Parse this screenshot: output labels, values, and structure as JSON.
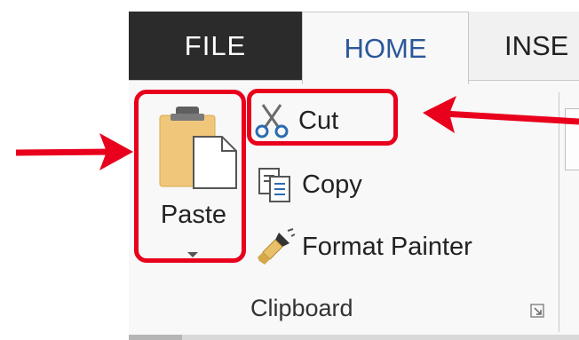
{
  "tabs": {
    "file": "FILE",
    "home": "HOME",
    "insert": "INSE"
  },
  "clipboard": {
    "paste_label": "Paste",
    "cut_label": "Cut",
    "copy_label": "Copy",
    "format_painter_label": "Format Painter",
    "group_label": "Clipboard"
  },
  "icons": {
    "paste": "clipboard-paste-icon",
    "cut": "scissors-icon",
    "copy": "copy-icon",
    "format_painter": "paintbrush-icon",
    "launcher": "dialog-launcher-icon"
  },
  "colors": {
    "file_tab_bg": "#2b2b2b",
    "home_tab_text": "#2b579a",
    "highlight": "#e8001c",
    "ribbon_bg": "#f8f8f8"
  }
}
